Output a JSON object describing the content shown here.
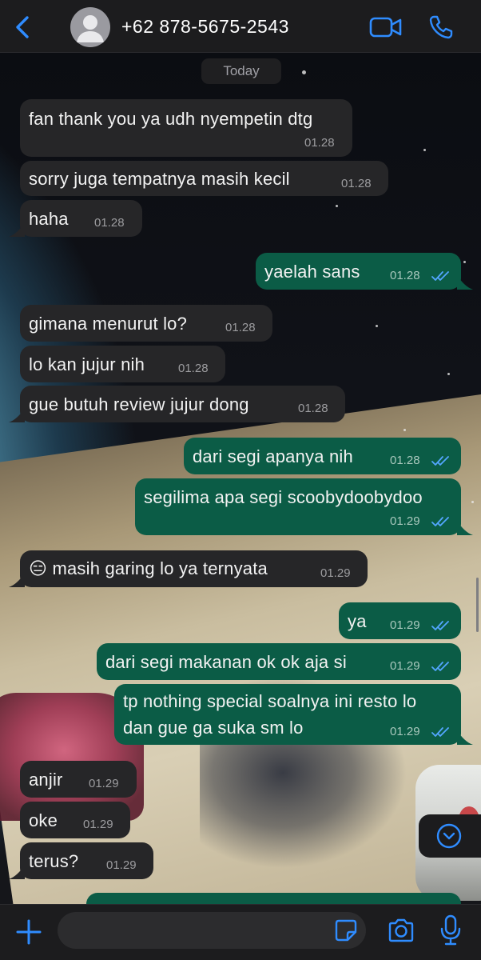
{
  "header": {
    "contact_name": "+62 878-5675-2543",
    "back_icon": "chevron-left-icon",
    "video_icon": "video-camera-icon",
    "call_icon": "phone-icon",
    "accent_color": "#2f8cff"
  },
  "chat": {
    "date_label": "Today",
    "messages": [
      {
        "direction": "in",
        "text": "fan thank you ya udh nyempetin dtg",
        "time": "01.28"
      },
      {
        "direction": "in",
        "text": "sorry juga tempatnya masih kecil",
        "time": "01.28"
      },
      {
        "direction": "in",
        "text": "haha",
        "time": "01.28"
      },
      {
        "direction": "out",
        "text": "yaelah sans",
        "time": "01.28",
        "status": "read"
      },
      {
        "direction": "in",
        "text": "gimana menurut lo?",
        "time": "01.28"
      },
      {
        "direction": "in",
        "text": "lo kan jujur nih",
        "time": "01.28"
      },
      {
        "direction": "in",
        "text": "gue butuh review jujur dong",
        "time": "01.28"
      },
      {
        "direction": "out",
        "text": "dari segi apanya nih",
        "time": "01.28",
        "status": "read"
      },
      {
        "direction": "out",
        "text": "segilima apa segi scoobydoobydoo",
        "time": "01.29",
        "status": "read"
      },
      {
        "direction": "in",
        "emoji": "😑",
        "text": "masih garing lo ya ternyata",
        "time": "01.29"
      },
      {
        "direction": "out",
        "text": "ya",
        "time": "01.29",
        "status": "read"
      },
      {
        "direction": "out",
        "text": "dari segi makanan ok ok aja si",
        "time": "01.29",
        "status": "read"
      },
      {
        "direction": "out",
        "text_line1": "tp nothing special soalnya ini resto lo",
        "text_line2": "dan gue ga suka sm lo",
        "time": "01.29",
        "status": "read"
      },
      {
        "direction": "in",
        "text": "anjir",
        "time": "01.29"
      },
      {
        "direction": "in",
        "text": "oke",
        "time": "01.29"
      },
      {
        "direction": "in",
        "text": "terus?",
        "time": "01.29"
      }
    ],
    "incoming_bubble_color": "#262628",
    "outgoing_bubble_color": "#0b5c46",
    "read_tick_color": "#53a6ff"
  },
  "composer": {
    "input_value": "",
    "plus_icon": "plus-icon",
    "sticker_icon": "sticker-icon",
    "camera_icon": "camera-icon",
    "mic_icon": "microphone-icon"
  },
  "scroll_button_icon": "chevron-down-circle-icon"
}
